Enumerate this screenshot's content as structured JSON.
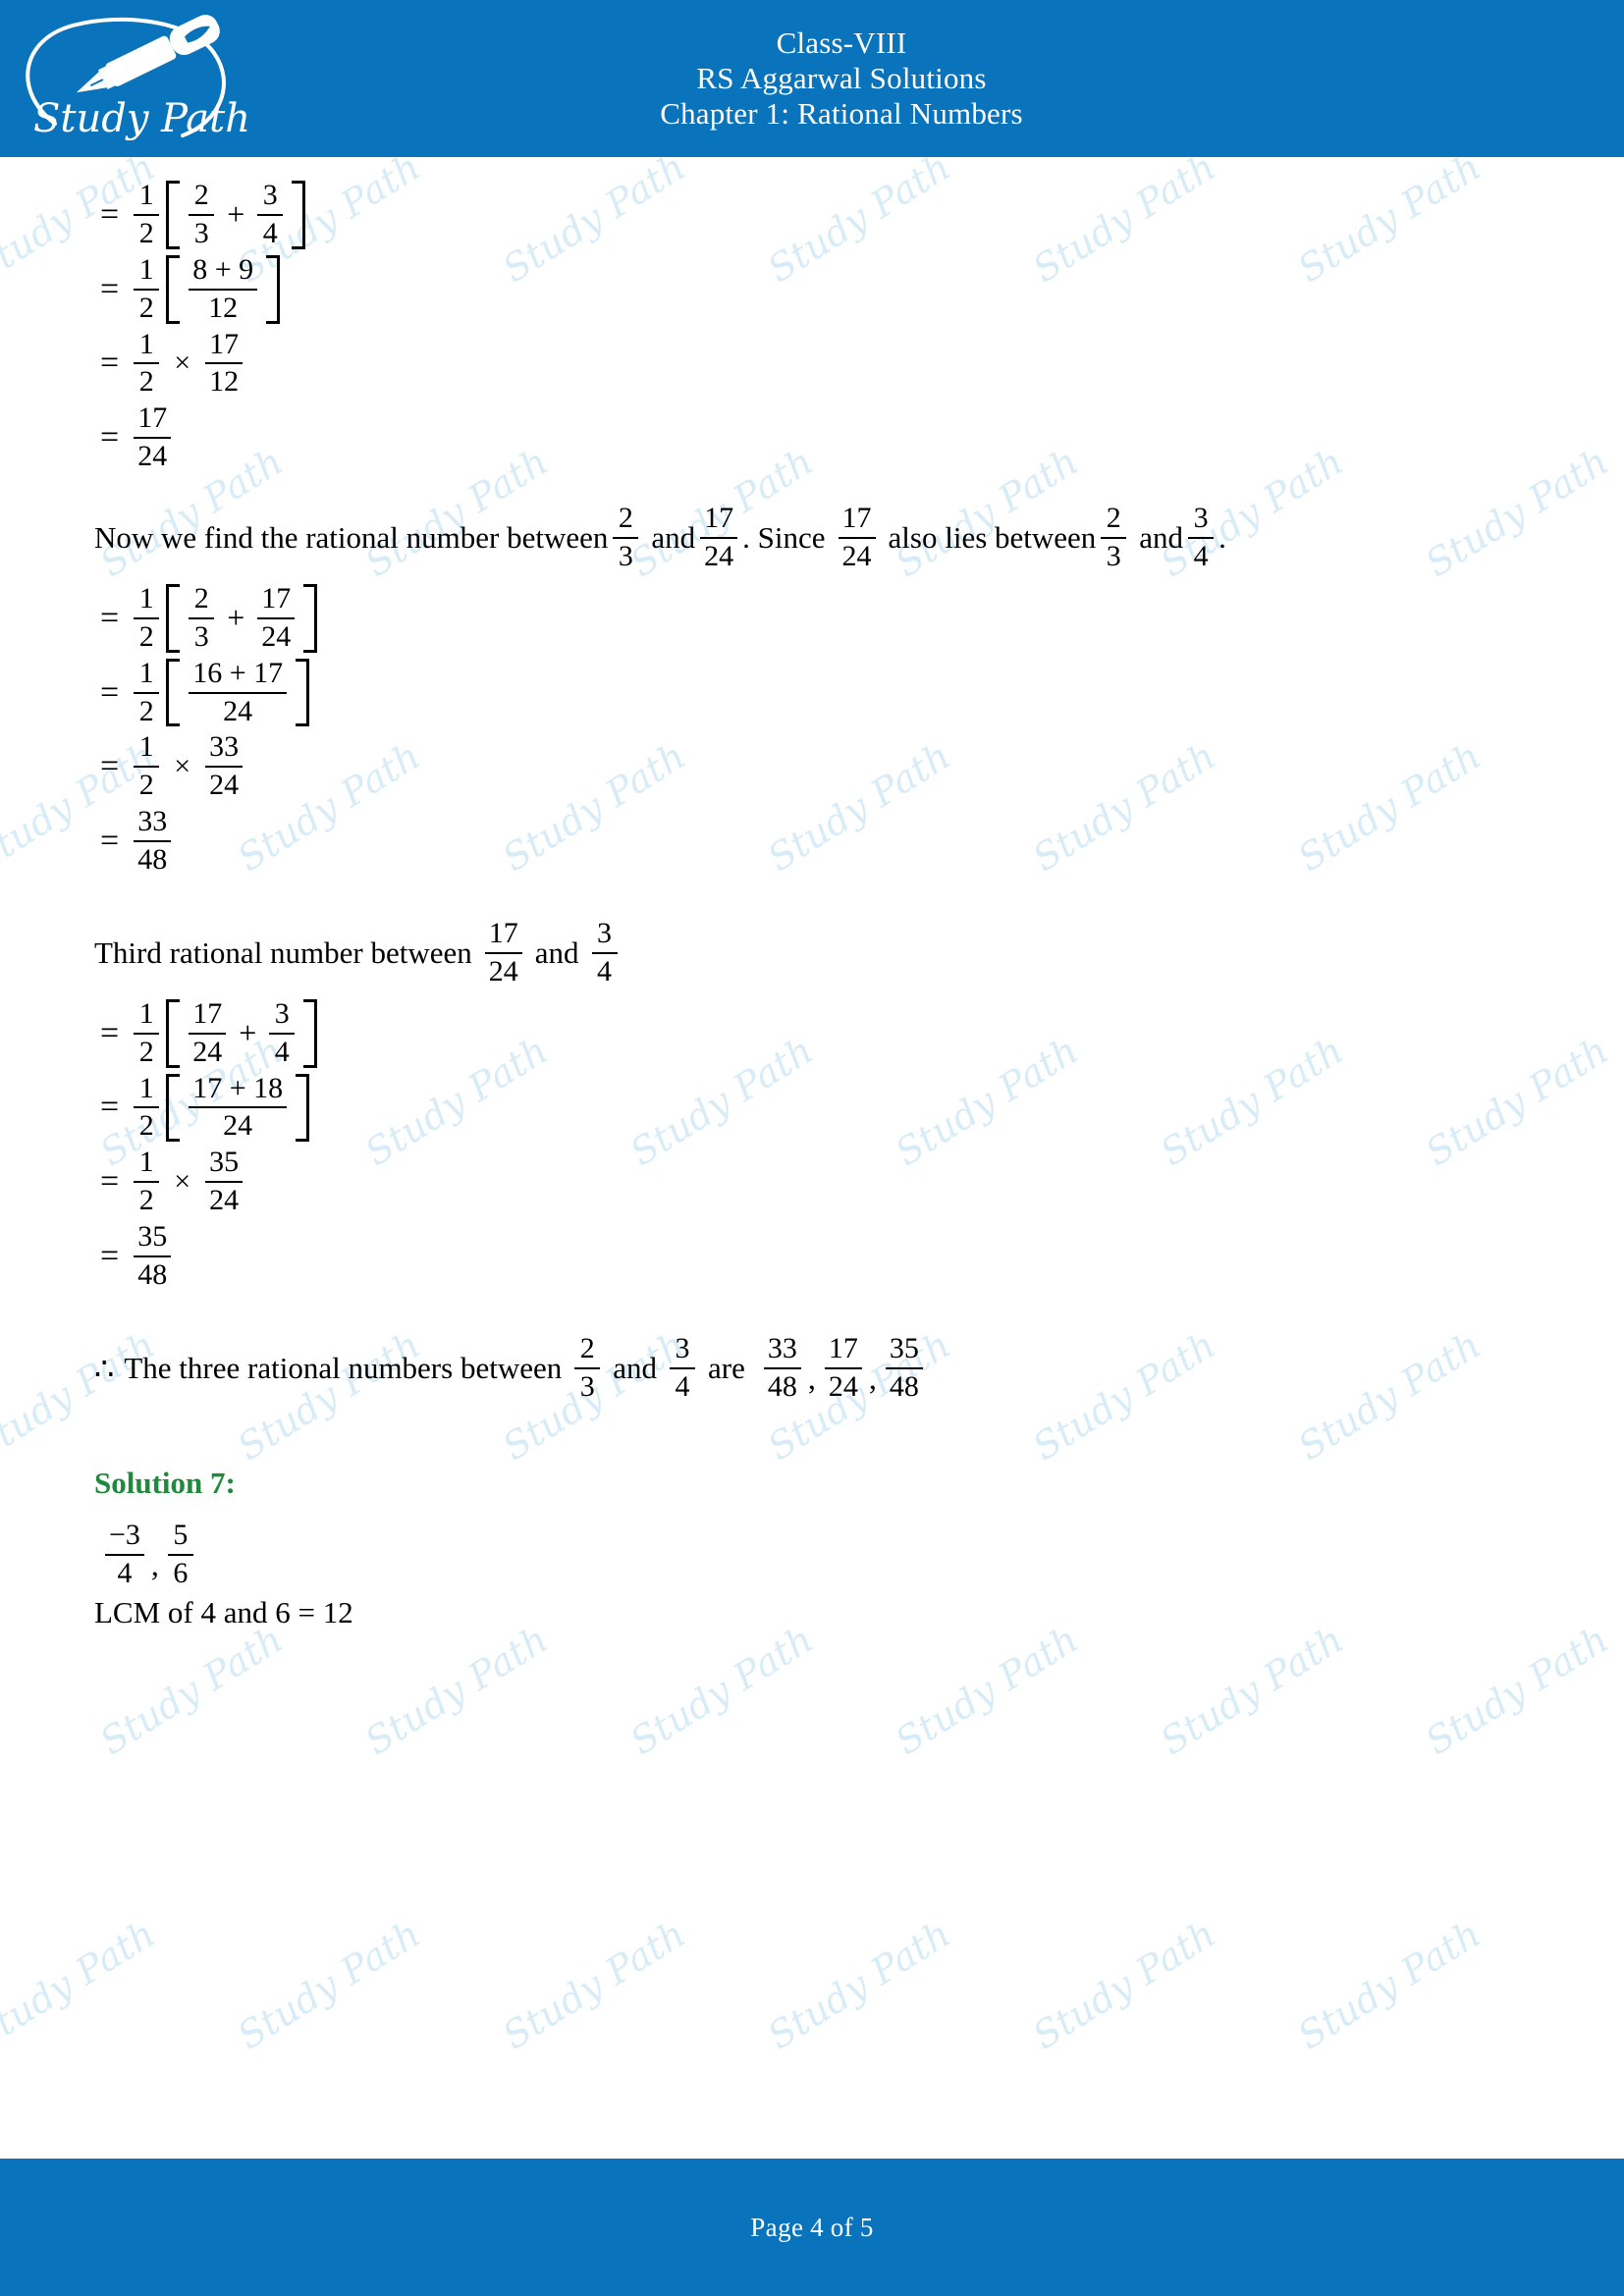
{
  "header": {
    "logo_alt": "Study Path",
    "logo_text": "Study Path",
    "line1": "Class-VIII",
    "line2": "RS Aggarwal Solutions",
    "line3": "Chapter 1: Rational Numbers"
  },
  "colors": {
    "brand_blue": "#0973BC",
    "heading_green": "#1F8A3B",
    "watermark_blue": "#D6ECF8",
    "text_black": "#000000"
  },
  "watermark": {
    "text": "Study Path",
    "count": 28
  },
  "body": {
    "eq1": {
      "eq": "=",
      "coef": {
        "num": "1",
        "den": "2"
      },
      "bracket": [
        {
          "num": "2",
          "den": "3"
        },
        {
          "op": "+"
        },
        {
          "num": "3",
          "den": "4"
        }
      ]
    },
    "eq2": {
      "eq": "=",
      "coef": {
        "num": "1",
        "den": "2"
      },
      "inner": {
        "num": "8 + 9",
        "den": "12"
      }
    },
    "eq3": {
      "eq": "=",
      "coef": {
        "num": "1",
        "den": "2"
      },
      "op": "×",
      "frac": {
        "num": "17",
        "den": "12"
      }
    },
    "eq4": {
      "eq": "=",
      "frac": {
        "num": "17",
        "den": "24"
      }
    },
    "para1": {
      "t1": "Now we find the rational number between",
      "f1": {
        "num": "2",
        "den": "3"
      },
      "t2": "and",
      "f2": {
        "num": "17",
        "den": "24"
      },
      "t3": ". Since",
      "f3": {
        "num": "17",
        "den": "24"
      },
      "t4": "also lies between",
      "f4": {
        "num": "2",
        "den": "3"
      },
      "t5": "and",
      "f5": {
        "num": "3",
        "den": "4"
      },
      "t6": "."
    },
    "eq5": {
      "eq": "=",
      "coef": {
        "num": "1",
        "den": "2"
      },
      "bracket": [
        {
          "num": "2",
          "den": "3"
        },
        {
          "op": "+"
        },
        {
          "num": "17",
          "den": "24"
        }
      ]
    },
    "eq6": {
      "eq": "=",
      "coef": {
        "num": "1",
        "den": "2"
      },
      "inner": {
        "num": "16 + 17",
        "den": "24"
      }
    },
    "eq7": {
      "eq": "=",
      "coef": {
        "num": "1",
        "den": "2"
      },
      "op": "×",
      "frac": {
        "num": "33",
        "den": "24"
      }
    },
    "eq8": {
      "eq": "=",
      "frac": {
        "num": "33",
        "den": "48"
      }
    },
    "para2": {
      "t1": "Third rational number between",
      "f1": {
        "num": "17",
        "den": "24"
      },
      "t2": "and",
      "f2": {
        "num": "3",
        "den": "4"
      }
    },
    "eq9": {
      "eq": "=",
      "coef": {
        "num": "1",
        "den": "2"
      },
      "bracket": [
        {
          "num": "17",
          "den": "24"
        },
        {
          "op": "+"
        },
        {
          "num": "3",
          "den": "4"
        }
      ]
    },
    "eq10": {
      "eq": "=",
      "coef": {
        "num": "1",
        "den": "2"
      },
      "inner": {
        "num": "17 + 18",
        "den": "24"
      }
    },
    "eq11": {
      "eq": "=",
      "coef": {
        "num": "1",
        "den": "2"
      },
      "op": "×",
      "frac": {
        "num": "35",
        "den": "24"
      }
    },
    "eq12": {
      "eq": "=",
      "frac": {
        "num": "35",
        "den": "48"
      }
    },
    "conclusion": {
      "symbol": "∴",
      "t1": "The three rational numbers between",
      "f1": {
        "num": "2",
        "den": "3"
      },
      "t2": "and",
      "f2": {
        "num": "3",
        "den": "4"
      },
      "t3": "are",
      "a1": {
        "num": "33",
        "den": "48"
      },
      "sep1": ",",
      "a2": {
        "num": "17",
        "den": "24"
      },
      "sep2": ",",
      "a3": {
        "num": "35",
        "den": "48"
      }
    },
    "solution7": {
      "heading": "Solution 7:",
      "f1": {
        "num": "−3",
        "den": "4"
      },
      "comma": ",",
      "f2": {
        "num": "5",
        "den": "6"
      },
      "lcm_line": "LCM of 4 and 6 = 12"
    }
  },
  "footer": {
    "prefix": "Page",
    "page": "4",
    "of": "of",
    "total": "5"
  }
}
